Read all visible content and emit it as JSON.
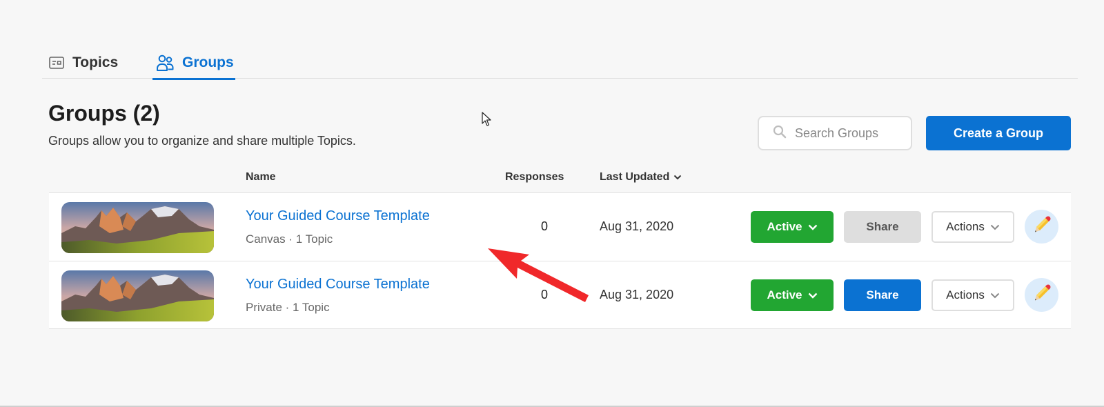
{
  "tabs": [
    {
      "label": "Topics",
      "icon": "topics-card-icon",
      "active": false
    },
    {
      "label": "Groups",
      "icon": "groups-people-icon",
      "active": true
    }
  ],
  "header": {
    "title": "Groups (2)",
    "subtitle": "Groups allow you to organize and share multiple Topics."
  },
  "search": {
    "placeholder": "Search Groups",
    "value": "",
    "icon": "search-icon"
  },
  "create_button": {
    "label": "Create a Group"
  },
  "table": {
    "columns": {
      "name": "Name",
      "responses": "Responses",
      "last_updated": "Last Updated"
    },
    "sort_icon": "chevron-down-icon",
    "rows": [
      {
        "title": "Your Guided Course Template",
        "meta": "Canvas · 1 Topic",
        "responses": "0",
        "last_updated": "Aug 31, 2020",
        "status_label": "Active",
        "share_label": "Share",
        "share_enabled": false,
        "actions_label": "Actions",
        "edit_icon": "pencil-icon"
      },
      {
        "title": "Your Guided Course Template",
        "meta": "Private · 1 Topic",
        "responses": "0",
        "last_updated": "Aug 31, 2020",
        "status_label": "Active",
        "share_label": "Share",
        "share_enabled": true,
        "actions_label": "Actions",
        "edit_icon": "pencil-icon"
      }
    ]
  },
  "colors": {
    "brand_blue": "#0b72d2",
    "active_green": "#22a632",
    "disabled_gray": "#dedede",
    "edit_circle": "#dcecfb",
    "annotation_red": "#f0282a",
    "background": "#f7f7f7"
  },
  "annotation": {
    "type": "arrow",
    "color": "red",
    "points_to": "row-1-title"
  }
}
